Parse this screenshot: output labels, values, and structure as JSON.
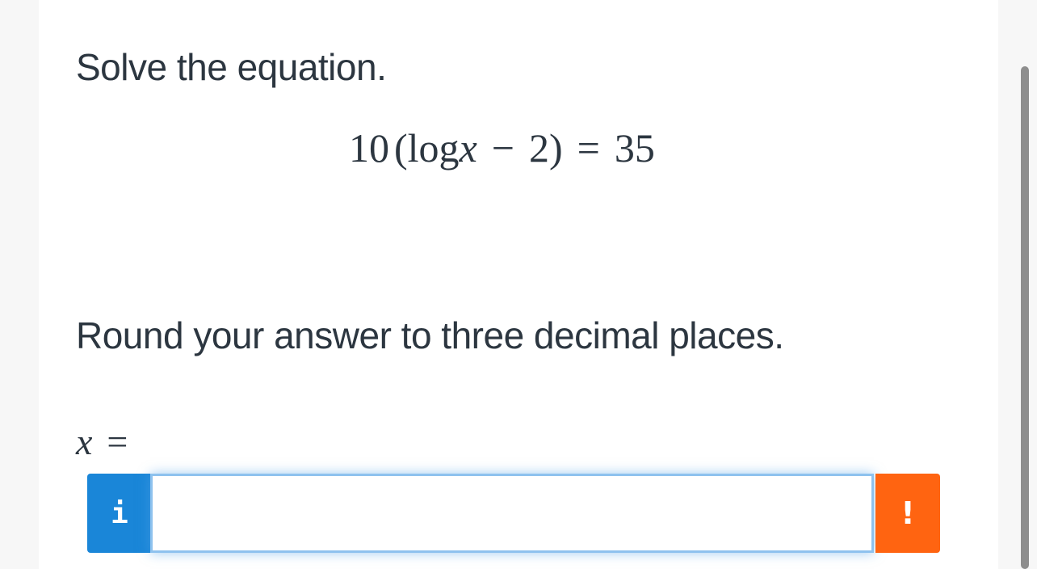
{
  "question": {
    "prompt": "Solve the equation.",
    "equation": {
      "coefficient": "10",
      "open_paren": "(",
      "func": "log",
      "variable": "x",
      "minus": "−",
      "constant": "2",
      "close_paren": ")",
      "equals": "=",
      "rhs": "35"
    },
    "instruction": "Round your answer to three decimal places."
  },
  "answer": {
    "variable": "x",
    "equals": "=",
    "value": "",
    "placeholder": "",
    "info_label": "i",
    "info_icon": "info-icon",
    "warn_label": "!",
    "warn_icon": "exclamation-icon"
  },
  "colors": {
    "info_button": "#1a86d8",
    "warn_button": "#ff6411",
    "input_focus": "#8ec2ee",
    "text": "#2c3640"
  }
}
